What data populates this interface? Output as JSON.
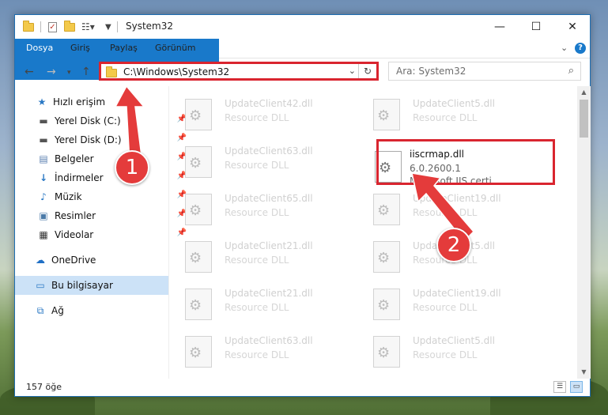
{
  "window": {
    "title": "System32",
    "minimize": "—",
    "maximize": "☐",
    "close": "✕"
  },
  "ribbon": {
    "tabs": [
      "Dosya",
      "Giriş",
      "Paylaş",
      "Görünüm"
    ]
  },
  "nav": {
    "address": "C:\\Windows\\System32",
    "search_placeholder": "Ara: System32"
  },
  "sidebar": {
    "items": [
      {
        "label": "Hızlı erişim",
        "icon": "star-icon"
      },
      {
        "label": "Yerel Disk (C:)",
        "icon": "drive-icon"
      },
      {
        "label": "Yerel Disk (D:)",
        "icon": "drive-icon"
      },
      {
        "label": "Belgeler",
        "icon": "documents-icon"
      },
      {
        "label": "İndirmeler",
        "icon": "download-icon"
      },
      {
        "label": "Müzik",
        "icon": "music-icon"
      },
      {
        "label": "Resimler",
        "icon": "pictures-icon"
      },
      {
        "label": "Videolar",
        "icon": "video-icon"
      },
      {
        "label": "OneDrive",
        "icon": "cloud-icon"
      },
      {
        "label": "Bu bilgisayar",
        "icon": "computer-icon"
      },
      {
        "label": "Ağ",
        "icon": "network-icon"
      }
    ]
  },
  "files": {
    "left": [
      {
        "name": "UpdateClient42.dll",
        "type": "Resource DLL"
      },
      {
        "name": "UpdateClient63.dll",
        "type": "Resource DLL"
      },
      {
        "name": "UpdateClient65.dll",
        "type": "Resource DLL"
      },
      {
        "name": "UpdateClient21.dll",
        "type": "Resource DLL"
      },
      {
        "name": "UpdateClient21.dll",
        "type": "Resource DLL"
      },
      {
        "name": "UpdateClient63.dll",
        "type": "Resource DLL"
      }
    ],
    "right": [
      {
        "name": "UpdateClient5.dll",
        "type": "Resource DLL"
      },
      {
        "name": "iiscrmap.dll",
        "type": "6.0.2600.1",
        "desc": "Microsoft IIS certi..."
      },
      {
        "name": "UpdateClient19.dll",
        "type": "Resource DLL"
      },
      {
        "name": "UpdateClient5.dll",
        "type": "Resource DLL"
      },
      {
        "name": "UpdateClient19.dll",
        "type": "Resource DLL"
      },
      {
        "name": "UpdateClient5.dll",
        "type": "Resource DLL"
      }
    ]
  },
  "status": {
    "count": "157 öğe"
  },
  "callouts": [
    "1",
    "2"
  ],
  "colors": {
    "accent": "#1979ca",
    "highlight": "#d9252f",
    "selected": "#cce2f7"
  }
}
